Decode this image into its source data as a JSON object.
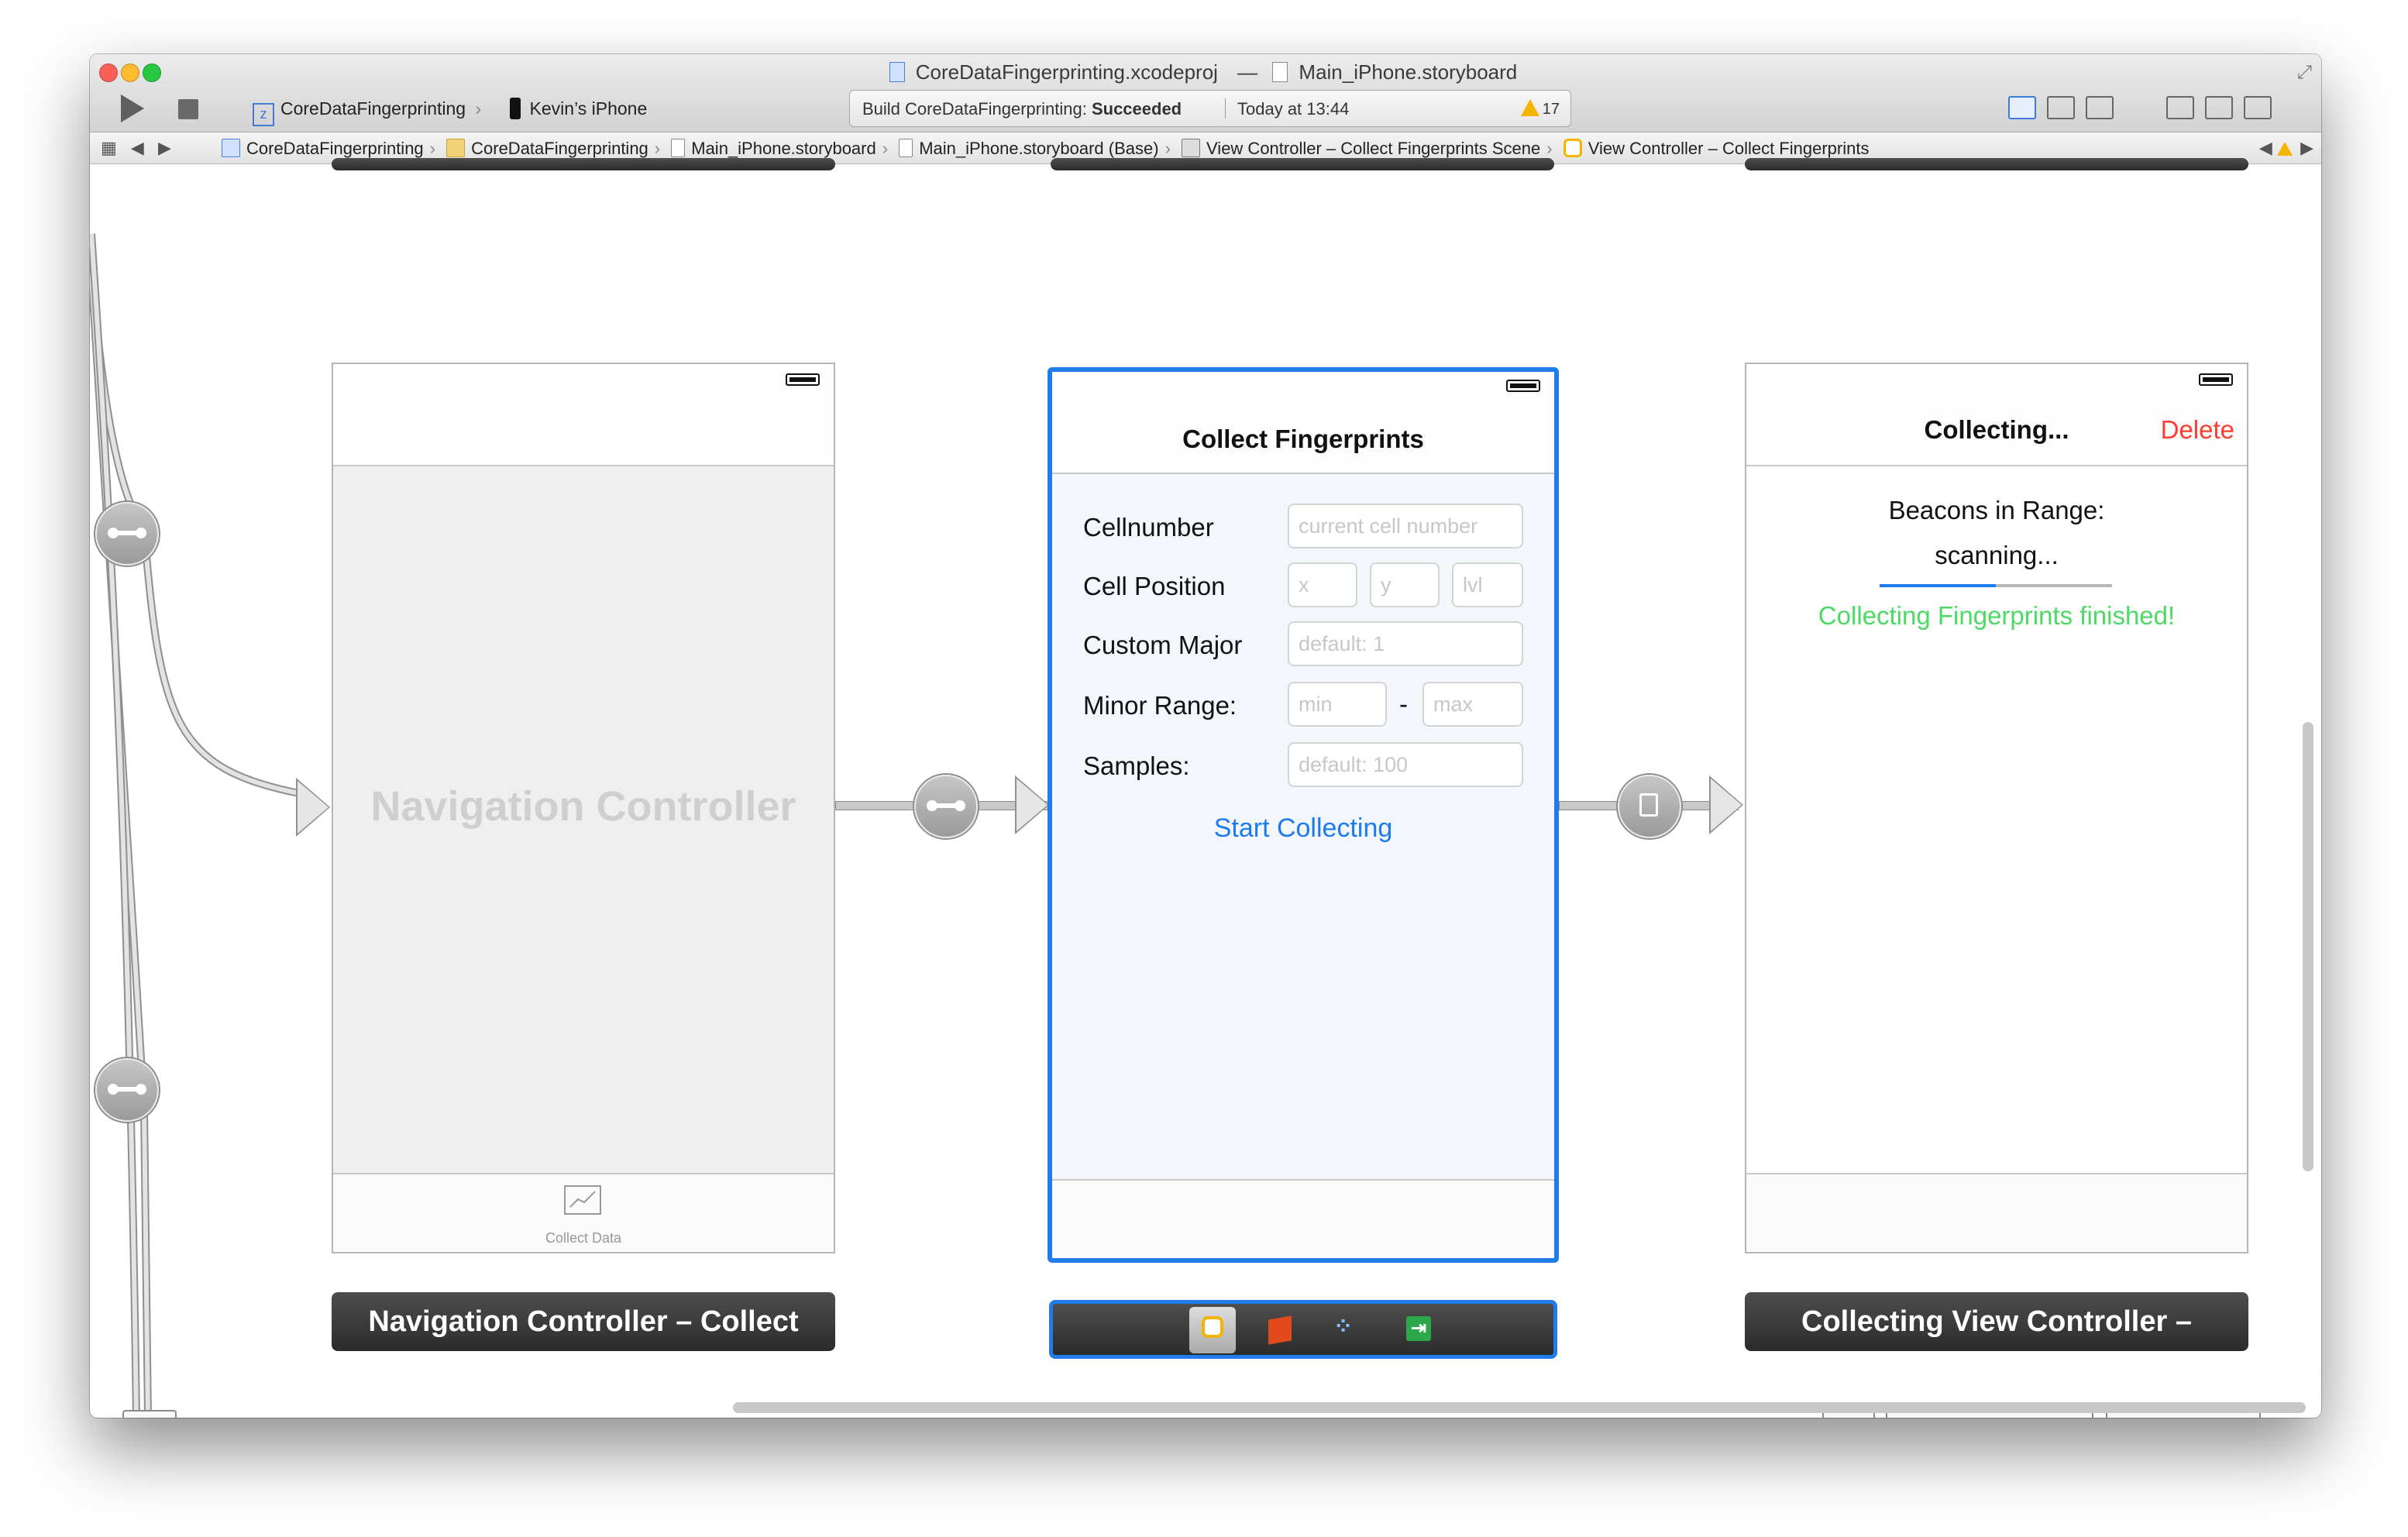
{
  "window": {
    "project_file": "CoreDataFingerprinting.xcodeproj",
    "separator": "—",
    "storyboard_file": "Main_iPhone.storyboard"
  },
  "toolbar": {
    "scheme_name": "CoreDataFingerprinting",
    "scheme_icon": "z",
    "device_name": "Kevin’s iPhone",
    "status_prefix": "Build CoreDataFingerprinting:",
    "status_result": "Succeeded",
    "status_time": "Today at 13:44",
    "warning_count": "17"
  },
  "jumpbar": {
    "crumbs": [
      {
        "label": "CoreDataFingerprinting",
        "icon": "project-icon"
      },
      {
        "label": "CoreDataFingerprinting",
        "icon": "folder-icon"
      },
      {
        "label": "Main_iPhone.storyboard",
        "icon": "storyboard-icon"
      },
      {
        "label": "Main_iPhone.storyboard (Base)",
        "icon": "storyboard-icon"
      },
      {
        "label": "View Controller – Collect Fingerprints Scene",
        "icon": "scene-icon"
      },
      {
        "label": "View Controller – Collect Fingerprints",
        "icon": "view-controller-icon"
      }
    ]
  },
  "nav_controller": {
    "placeholder": "Navigation Controller",
    "tab_item": "Collect Data",
    "dock_label": "Navigation Controller – Collect"
  },
  "collect_vc": {
    "title": "Collect Fingerprints",
    "labels": {
      "cellnumber": "Cellnumber",
      "cell_position": "Cell Position",
      "custom_major": "Custom Major",
      "minor_range": "Minor Range:",
      "samples": "Samples:"
    },
    "placeholders": {
      "cellnumber": "current cell number",
      "x": "x",
      "y": "y",
      "lvl": "lvl",
      "major": "default: 1",
      "min": "min",
      "dash": "-",
      "max": "max",
      "samples": "default: 100"
    },
    "start_button": "Start Collecting"
  },
  "collecting_vc": {
    "title": "Collecting...",
    "delete": "Delete",
    "beacons_label": "Beacons in Range:",
    "scanning": "scanning...",
    "progress": 0.5,
    "finished": "Collecting Fingerprints finished!",
    "dock_label": "Collecting View Controller –"
  },
  "colors": {
    "accent": "#1f7ce8",
    "delete_red": "#ff3b30",
    "finished_green": "#4cd964",
    "link_blue": "#1a7cf0"
  }
}
